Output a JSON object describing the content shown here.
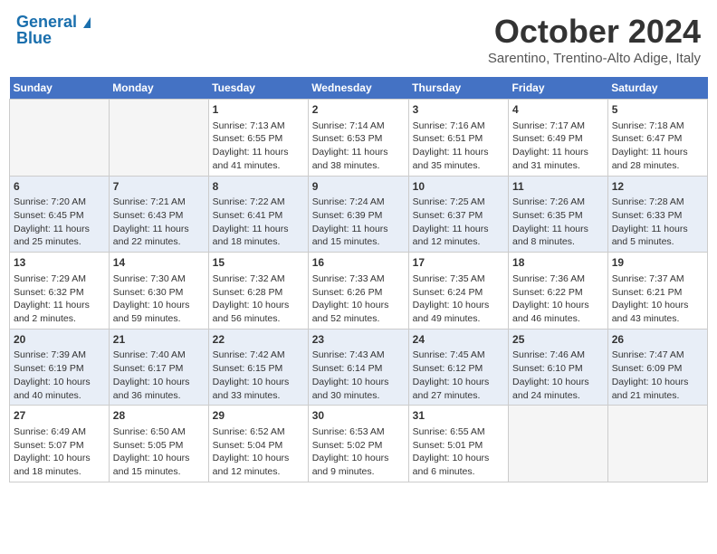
{
  "header": {
    "logo_line1": "General",
    "logo_line2": "Blue",
    "month": "October 2024",
    "location": "Sarentino, Trentino-Alto Adige, Italy"
  },
  "days_of_week": [
    "Sunday",
    "Monday",
    "Tuesday",
    "Wednesday",
    "Thursday",
    "Friday",
    "Saturday"
  ],
  "weeks": [
    [
      {
        "day": "",
        "info": ""
      },
      {
        "day": "",
        "info": ""
      },
      {
        "day": "1",
        "info": "Sunrise: 7:13 AM\nSunset: 6:55 PM\nDaylight: 11 hours and 41 minutes."
      },
      {
        "day": "2",
        "info": "Sunrise: 7:14 AM\nSunset: 6:53 PM\nDaylight: 11 hours and 38 minutes."
      },
      {
        "day": "3",
        "info": "Sunrise: 7:16 AM\nSunset: 6:51 PM\nDaylight: 11 hours and 35 minutes."
      },
      {
        "day": "4",
        "info": "Sunrise: 7:17 AM\nSunset: 6:49 PM\nDaylight: 11 hours and 31 minutes."
      },
      {
        "day": "5",
        "info": "Sunrise: 7:18 AM\nSunset: 6:47 PM\nDaylight: 11 hours and 28 minutes."
      }
    ],
    [
      {
        "day": "6",
        "info": "Sunrise: 7:20 AM\nSunset: 6:45 PM\nDaylight: 11 hours and 25 minutes."
      },
      {
        "day": "7",
        "info": "Sunrise: 7:21 AM\nSunset: 6:43 PM\nDaylight: 11 hours and 22 minutes."
      },
      {
        "day": "8",
        "info": "Sunrise: 7:22 AM\nSunset: 6:41 PM\nDaylight: 11 hours and 18 minutes."
      },
      {
        "day": "9",
        "info": "Sunrise: 7:24 AM\nSunset: 6:39 PM\nDaylight: 11 hours and 15 minutes."
      },
      {
        "day": "10",
        "info": "Sunrise: 7:25 AM\nSunset: 6:37 PM\nDaylight: 11 hours and 12 minutes."
      },
      {
        "day": "11",
        "info": "Sunrise: 7:26 AM\nSunset: 6:35 PM\nDaylight: 11 hours and 8 minutes."
      },
      {
        "day": "12",
        "info": "Sunrise: 7:28 AM\nSunset: 6:33 PM\nDaylight: 11 hours and 5 minutes."
      }
    ],
    [
      {
        "day": "13",
        "info": "Sunrise: 7:29 AM\nSunset: 6:32 PM\nDaylight: 11 hours and 2 minutes."
      },
      {
        "day": "14",
        "info": "Sunrise: 7:30 AM\nSunset: 6:30 PM\nDaylight: 10 hours and 59 minutes."
      },
      {
        "day": "15",
        "info": "Sunrise: 7:32 AM\nSunset: 6:28 PM\nDaylight: 10 hours and 56 minutes."
      },
      {
        "day": "16",
        "info": "Sunrise: 7:33 AM\nSunset: 6:26 PM\nDaylight: 10 hours and 52 minutes."
      },
      {
        "day": "17",
        "info": "Sunrise: 7:35 AM\nSunset: 6:24 PM\nDaylight: 10 hours and 49 minutes."
      },
      {
        "day": "18",
        "info": "Sunrise: 7:36 AM\nSunset: 6:22 PM\nDaylight: 10 hours and 46 minutes."
      },
      {
        "day": "19",
        "info": "Sunrise: 7:37 AM\nSunset: 6:21 PM\nDaylight: 10 hours and 43 minutes."
      }
    ],
    [
      {
        "day": "20",
        "info": "Sunrise: 7:39 AM\nSunset: 6:19 PM\nDaylight: 10 hours and 40 minutes."
      },
      {
        "day": "21",
        "info": "Sunrise: 7:40 AM\nSunset: 6:17 PM\nDaylight: 10 hours and 36 minutes."
      },
      {
        "day": "22",
        "info": "Sunrise: 7:42 AM\nSunset: 6:15 PM\nDaylight: 10 hours and 33 minutes."
      },
      {
        "day": "23",
        "info": "Sunrise: 7:43 AM\nSunset: 6:14 PM\nDaylight: 10 hours and 30 minutes."
      },
      {
        "day": "24",
        "info": "Sunrise: 7:45 AM\nSunset: 6:12 PM\nDaylight: 10 hours and 27 minutes."
      },
      {
        "day": "25",
        "info": "Sunrise: 7:46 AM\nSunset: 6:10 PM\nDaylight: 10 hours and 24 minutes."
      },
      {
        "day": "26",
        "info": "Sunrise: 7:47 AM\nSunset: 6:09 PM\nDaylight: 10 hours and 21 minutes."
      }
    ],
    [
      {
        "day": "27",
        "info": "Sunrise: 6:49 AM\nSunset: 5:07 PM\nDaylight: 10 hours and 18 minutes."
      },
      {
        "day": "28",
        "info": "Sunrise: 6:50 AM\nSunset: 5:05 PM\nDaylight: 10 hours and 15 minutes."
      },
      {
        "day": "29",
        "info": "Sunrise: 6:52 AM\nSunset: 5:04 PM\nDaylight: 10 hours and 12 minutes."
      },
      {
        "day": "30",
        "info": "Sunrise: 6:53 AM\nSunset: 5:02 PM\nDaylight: 10 hours and 9 minutes."
      },
      {
        "day": "31",
        "info": "Sunrise: 6:55 AM\nSunset: 5:01 PM\nDaylight: 10 hours and 6 minutes."
      },
      {
        "day": "",
        "info": ""
      },
      {
        "day": "",
        "info": ""
      }
    ]
  ]
}
